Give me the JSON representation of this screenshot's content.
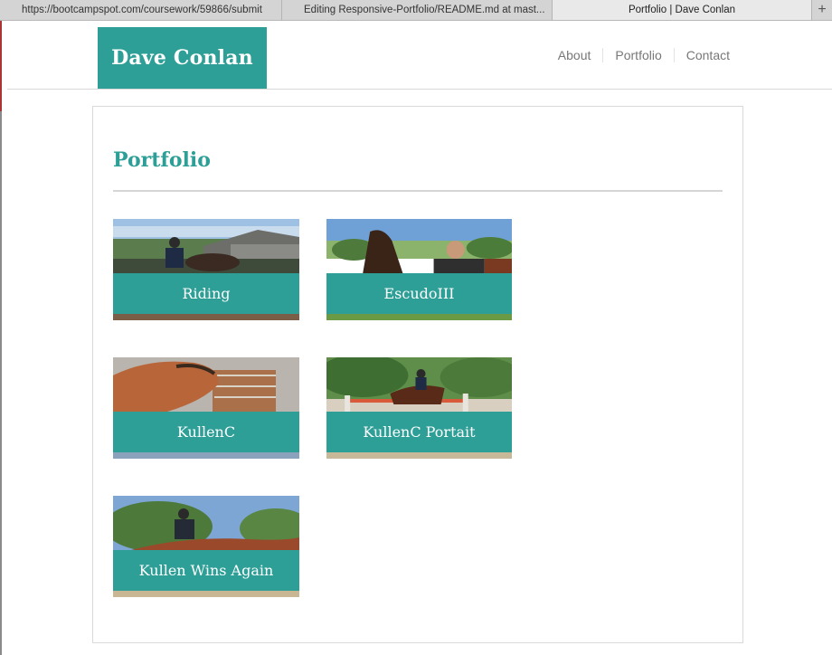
{
  "browser": {
    "tabs": [
      {
        "label": "https://bootcampspot.com/coursework/59866/submit"
      },
      {
        "label": "Editing Responsive-Portfolio/README.md at mast..."
      },
      {
        "label": "Portfolio | Dave Conlan"
      }
    ],
    "new_tab_label": "+"
  },
  "site": {
    "logo_text": "Dave Conlan",
    "nav": [
      {
        "label": "About"
      },
      {
        "label": "Portfolio"
      },
      {
        "label": "Contact"
      }
    ]
  },
  "portfolio": {
    "heading": "Portfolio",
    "items": [
      {
        "label": "Riding"
      },
      {
        "label": "EscudoIII"
      },
      {
        "label": "KullenC"
      },
      {
        "label": "KullenC Portait"
      },
      {
        "label": "Kullen Wins Again"
      }
    ]
  },
  "colors": {
    "accent": "#2d9f97",
    "nav_text": "#777777",
    "border": "#d9d9d9"
  }
}
